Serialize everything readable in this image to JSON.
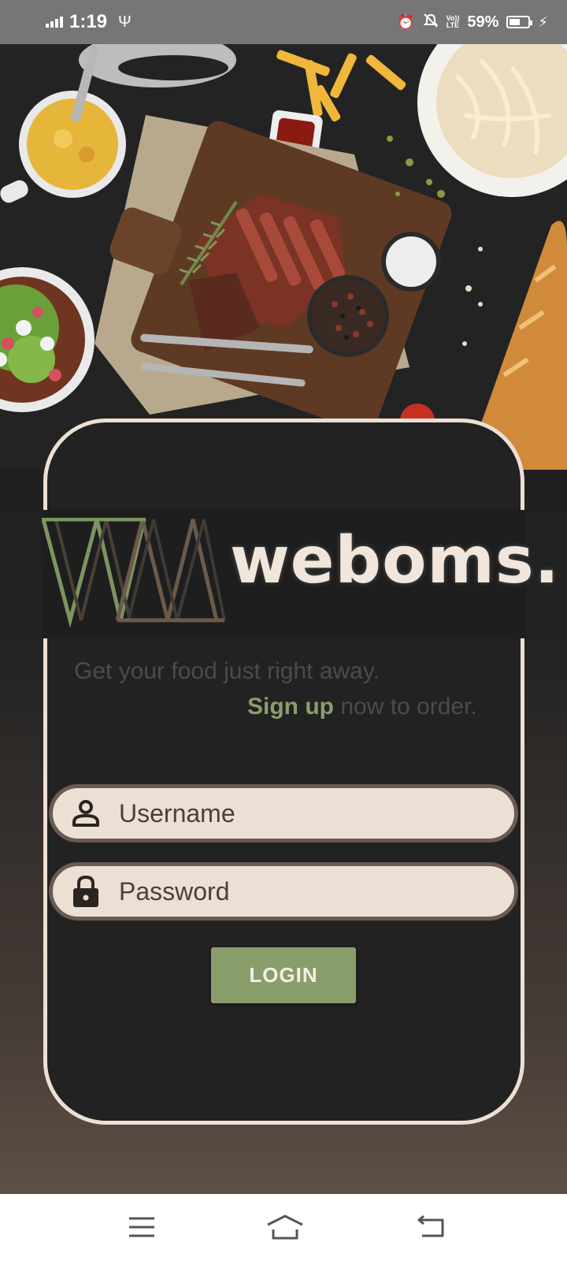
{
  "status_bar": {
    "time": "1:19",
    "usb_glyph": "Ψ",
    "alarm_glyph": "⏰",
    "mute_glyph": "🔕",
    "volte_top": "Vo))",
    "volte_bottom": "LTE",
    "battery_percent": "59%",
    "battery_level": 0.59,
    "charging_glyph": "⚡",
    "icons": [
      "signal-icon",
      "usb-icon",
      "alarm-icon",
      "mute-icon",
      "volte-icon",
      "battery-icon",
      "charging-icon"
    ]
  },
  "hero": {
    "icon": "food-spread-image"
  },
  "brand": {
    "name": "weboms.",
    "mark_icon": "wm-logo-mark"
  },
  "tagline": {
    "line1": "Get your food just right away.",
    "signup_link": "Sign up",
    "line2_rest": " now to order."
  },
  "form": {
    "username_placeholder": "Username",
    "username_value": "",
    "username_icon": "person-icon",
    "password_placeholder": "Password",
    "password_value": "",
    "password_icon": "lock-icon",
    "login_label": "LOGIN"
  },
  "nav_bar": {
    "icons": [
      "menu-icon",
      "home-icon",
      "back-icon"
    ]
  },
  "colors": {
    "accent_green": "#8a9e6c",
    "card_border": "#ecdfd4",
    "field_bg": "#ecdfd4",
    "field_border": "#6b5a51",
    "card_bg": "#222222",
    "status_bar_bg": "#767676"
  }
}
